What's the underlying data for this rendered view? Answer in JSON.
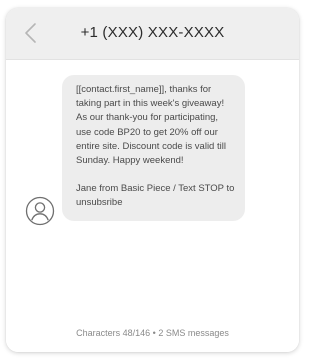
{
  "header": {
    "title": "+1 (XXX) XXX-XXXX",
    "back_icon": "chevron-left-icon"
  },
  "conversation": {
    "avatar_icon": "user-icon",
    "message": {
      "paragraph_1": "[[contact.first_name]], thanks for taking part in this week's giveaway! As our thank-you for participating, use code BP20 to get 20% off our entire site. Discount code is valid till Sunday. Happy weekend!",
      "paragraph_2": "Jane from Basic Piece / Text STOP to unsubsribe"
    }
  },
  "footer": {
    "stats": "Characters 48/146 • 2 SMS messages"
  },
  "colors": {
    "header_bg": "#efefef",
    "bubble_bg": "#ededed",
    "text": "#4a4a4a",
    "muted": "#8a8a8a"
  }
}
